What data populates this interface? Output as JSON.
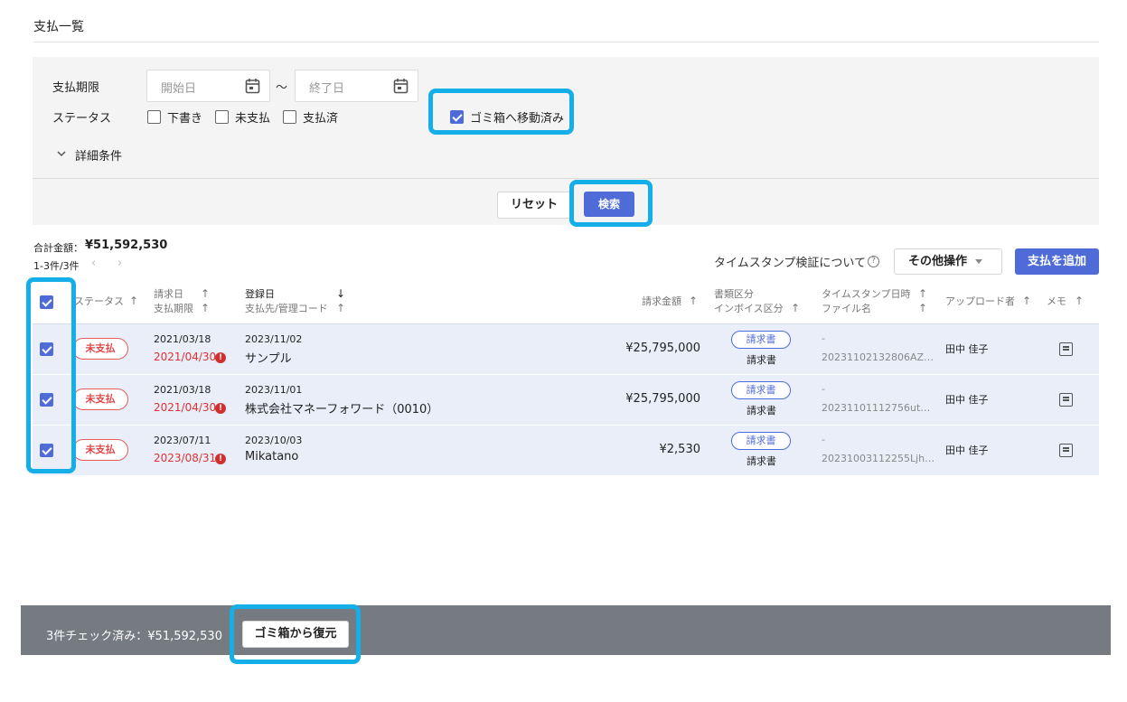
{
  "page": {
    "title": "支払一覧"
  },
  "filters": {
    "due_label": "支払期限",
    "start_placeholder": "開始日",
    "tilde": "～",
    "end_placeholder": "終了日",
    "status_label": "ステータス",
    "statuses": [
      {
        "label": "下書き",
        "checked": false
      },
      {
        "label": "未支払",
        "checked": false
      },
      {
        "label": "支払済",
        "checked": false
      }
    ],
    "trash": {
      "label": "ゴミ箱へ移動済み",
      "checked": true
    },
    "detail_label": "詳細条件",
    "detail_icon": "chevron-down-icon",
    "reset_label": "リセット",
    "search_label": "検索"
  },
  "summary": {
    "total_label": "合計金額：",
    "total_value": "¥51,592,530",
    "count": "1-3件/3件"
  },
  "toolbar": {
    "timestamp_link": "タイムスタンプ検証について",
    "more_label": "その他操作",
    "add_label": "支払を追加"
  },
  "table": {
    "headers": {
      "status": "ステータス",
      "invoice_date": "請求日",
      "due_date": "支払期限",
      "registered": "登録日",
      "payee": "支払先/管理コード",
      "amount": "請求金額",
      "doc_type": "書類区分",
      "invoice_type": "インボイス区分",
      "timestamp": "タイムスタンプ日時",
      "filename": "ファイル名",
      "uploader": "アップロード者",
      "memo": "メモ"
    },
    "rows": [
      {
        "checked": true,
        "status": "未支払",
        "invoice_date": "2021/03/18",
        "due_date": "2021/04/30",
        "registered": "2023/11/02",
        "payee": "サンプル",
        "amount": "¥25,795,000",
        "doc_type": "請求書",
        "invoice_type": "請求書",
        "timestamp": "-",
        "filename": "20231102132806AZ…",
        "uploader": "田中 佳子"
      },
      {
        "checked": true,
        "status": "未支払",
        "invoice_date": "2021/03/18",
        "due_date": "2021/04/30",
        "registered": "2023/11/01",
        "payee": "株式会社マネーフォワード（0010）",
        "amount": "¥25,795,000",
        "doc_type": "請求書",
        "invoice_type": "請求書",
        "timestamp": "-",
        "filename": "20231101112756ut…",
        "uploader": "田中 佳子"
      },
      {
        "checked": true,
        "status": "未支払",
        "invoice_date": "2023/07/11",
        "due_date": "2023/08/31",
        "registered": "2023/10/03",
        "payee": "Mikatano",
        "amount": "¥2,530",
        "doc_type": "請求書",
        "invoice_type": "請求書",
        "timestamp": "-",
        "filename": "20231003112255Ljh…",
        "uploader": "田中 佳子"
      }
    ]
  },
  "bottom_bar": {
    "checked_text": "3件チェック済み：¥51,592,530",
    "restore_label": "ゴミ箱から復元"
  },
  "colors": {
    "accent": "#4f6bd8",
    "highlight": "#14aee8",
    "unpaid": "#e04848",
    "row_bg": "#eaeef9",
    "bottom_bar": "#767b82"
  }
}
